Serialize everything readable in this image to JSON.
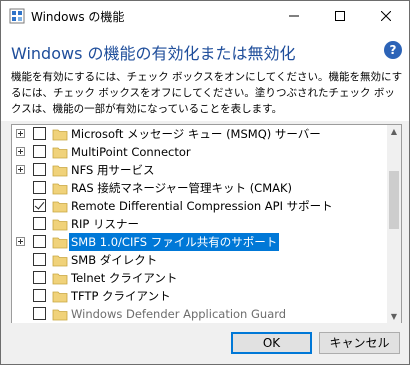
{
  "window": {
    "title": "Windows の機能",
    "minimize_glyph": "—",
    "maximize_glyph": "☐",
    "close_glyph": "✕"
  },
  "header": {
    "heading": "Windows の機能の有効化または無効化",
    "help_label": "?",
    "description": "機能を有効にするには、チェック ボックスをオンにしてください。機能を無効にするには、チェック ボックスをオフにしてください。塗りつぶされたチェック ボックスは、機能の一部が有効になっていることを表します。"
  },
  "features": [
    {
      "label": "Microsoft メッセージ キュー (MSMQ) サーバー",
      "expandable": true,
      "checked": false
    },
    {
      "label": "MultiPoint Connector",
      "expandable": true,
      "checked": false
    },
    {
      "label": "NFS 用サービス",
      "expandable": true,
      "checked": false
    },
    {
      "label": "RAS 接続マネージャー管理キット (CMAK)",
      "expandable": false,
      "checked": false
    },
    {
      "label": "Remote Differential Compression API サポート",
      "expandable": false,
      "checked": true
    },
    {
      "label": "RIP リスナー",
      "expandable": false,
      "checked": false
    },
    {
      "label": "SMB 1.0/CIFS ファイル共有のサポート",
      "expandable": true,
      "checked": false,
      "selected": true
    },
    {
      "label": "SMB ダイレクト",
      "expandable": false,
      "checked": false
    },
    {
      "label": "Telnet クライアント",
      "expandable": false,
      "checked": false
    },
    {
      "label": "TFTP クライアント",
      "expandable": false,
      "checked": false
    },
    {
      "label": "Windows Defender Application Guard",
      "expandable": false,
      "checked": false,
      "dimmed": true
    }
  ],
  "buttons": {
    "ok": "OK",
    "cancel": "キャンセル"
  },
  "colors": {
    "accent": "#0078d7",
    "heading": "#1f4e9b",
    "folder": "#f0d27a",
    "help": "#2c63b7"
  },
  "icons": {
    "expand": "plus-expander-icon",
    "folder": "folder-icon",
    "check": "checkmark-icon",
    "help": "question-mark-icon"
  }
}
